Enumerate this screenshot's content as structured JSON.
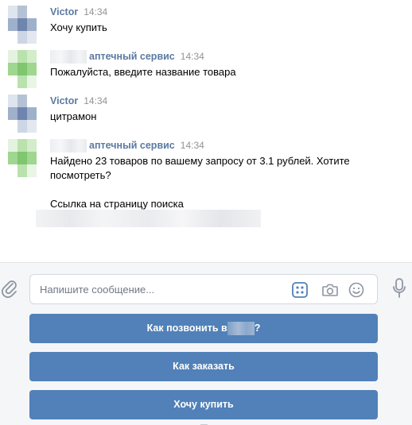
{
  "messages": [
    {
      "author": "Victor",
      "time": "14:34",
      "text": "Хочу купить",
      "avatar_colors": [
        "#8fa4c4",
        "#c5d0e0",
        "#6e86ae",
        "#dde3ed"
      ]
    },
    {
      "author": "аптечный сервис",
      "time": "14:34",
      "text": "Пожалуйста, введите название товара",
      "avatar_colors": [
        "#a9d99a",
        "#cdebc4",
        "#88c97a",
        "#e6f4e1"
      ]
    },
    {
      "author": "Victor",
      "time": "14:34",
      "text": "цитрамон",
      "avatar_colors": [
        "#8fa4c4",
        "#c5d0e0",
        "#6e86ae",
        "#dde3ed"
      ]
    },
    {
      "author": "аптечный сервис",
      "time": "14:34",
      "text": "Найдено 23 товаров по вашему запросу от 3.1 рублей. Хотите посмотреть?",
      "link_text": "Ссылка на страницу поиска",
      "avatar_colors": [
        "#a9d99a",
        "#cdebc4",
        "#88c97a",
        "#e6f4e1"
      ]
    }
  ],
  "composer": {
    "placeholder": "Напишите сообщение...",
    "icons": [
      "paperclip-icon",
      "keyboard-icon",
      "camera-icon",
      "smile-icon",
      "microphone-icon"
    ]
  },
  "keyboard": {
    "buttons": [
      {
        "label_before": "Как позвонить в",
        "label_after": "?"
      },
      {
        "label": "Как заказать"
      },
      {
        "label": "Хочу купить"
      }
    ]
  },
  "colors": {
    "author_link": "#5b7aa1",
    "button_bg": "#5181b8",
    "composer_bg": "#f5f6f8"
  }
}
